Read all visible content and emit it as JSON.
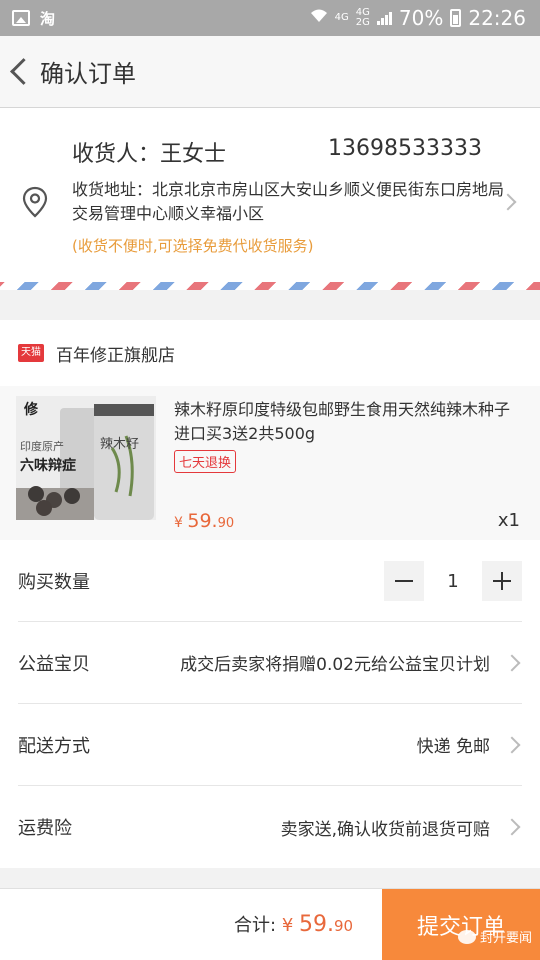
{
  "status_bar": {
    "app": "淘",
    "network_top": "4G",
    "network_left": "4G",
    "network_right": "2G",
    "battery": "70%",
    "time": "22:26"
  },
  "nav": {
    "title": "确认订单"
  },
  "address": {
    "receiver": "收货人：王女士",
    "phone": "13698533333",
    "detail": "收货地址：北京北京市房山区大安山乡顺义便民街东口房地局交易管理中心顺义幸福小区",
    "hint": "(收货不便时,可选择免费代收货服务)"
  },
  "shop": {
    "badge": "天猫",
    "name": "百年修正旗舰店"
  },
  "product": {
    "title": "辣木籽原印度特级包邮野生食用天然纯辣木种子进口买3送2共500g",
    "badge": "七天退换",
    "price_symbol": "¥",
    "price_int": "59.",
    "price_dec": "90",
    "qty": "x1",
    "thumb_text": [
      "修",
      "印度原产",
      "六味辩症",
      "辣木籽"
    ]
  },
  "rows": {
    "quantity": {
      "label": "购买数量",
      "value": "1"
    },
    "charity": {
      "label": "公益宝贝",
      "value": "成交后卖家将捐赠0.02元给公益宝贝计划"
    },
    "shipping": {
      "label": "配送方式",
      "value": "快递 免邮"
    },
    "insurance": {
      "label": "运费险",
      "value": "卖家送,确认收货前退货可赔"
    }
  },
  "bottom": {
    "total_label": "合计:",
    "price_symbol": "¥",
    "price_int": "59.",
    "price_dec": "90",
    "submit": "提交订单",
    "watermark": "封开要闻"
  },
  "colors": {
    "accent": "#f7893b",
    "price": "#e8683b",
    "tmall": "#e4393c",
    "hint": "#e89c3c"
  }
}
